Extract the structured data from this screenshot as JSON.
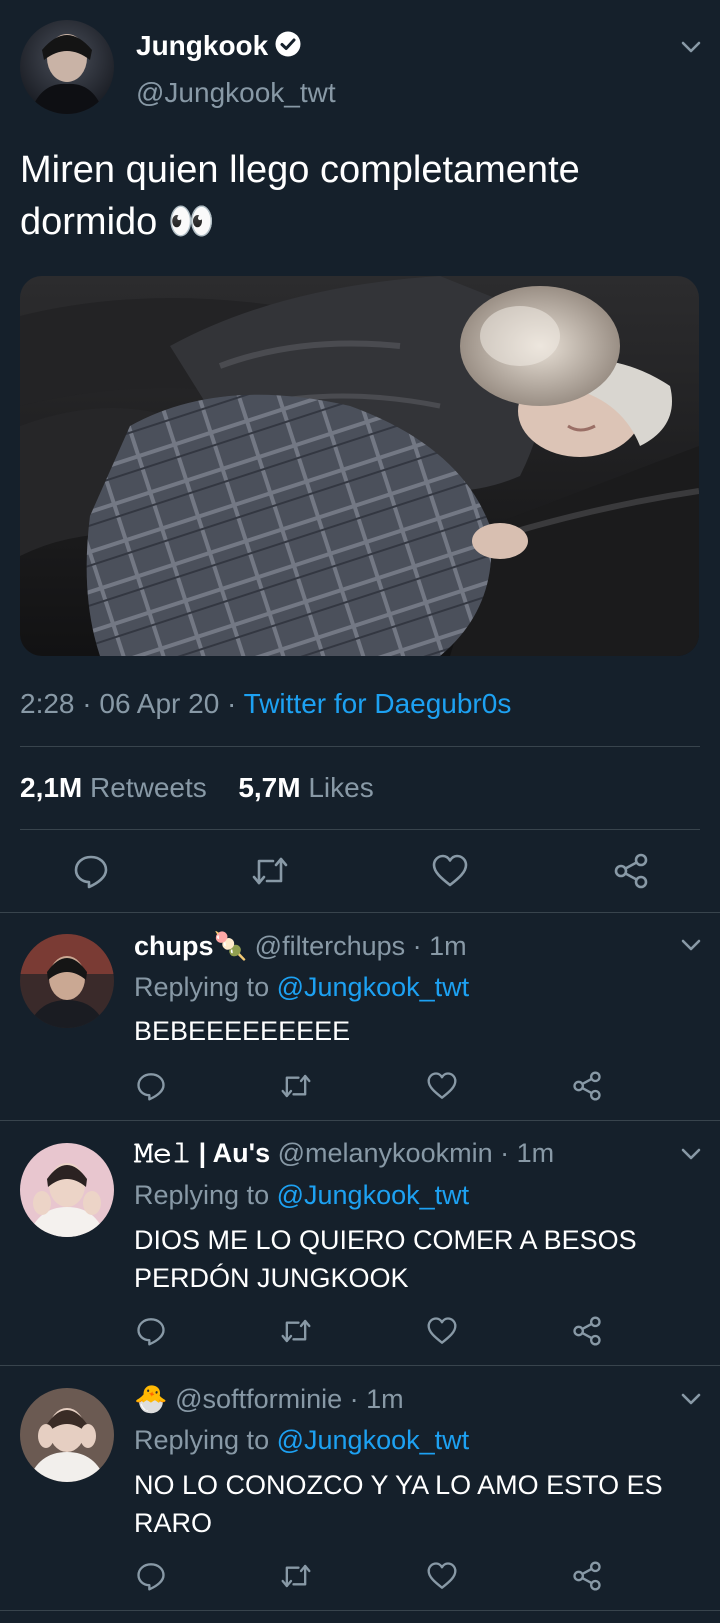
{
  "main_tweet": {
    "display_name": "Jungkook",
    "handle": "@Jungkook_twt",
    "text_line1": "Miren quien llego completamente",
    "text_line2": "dormido 👀",
    "time": "2:28",
    "date": "06 Apr 20",
    "source": "Twitter for Daegubr0s",
    "separator": "·",
    "retweets_count": "2,1M",
    "retweets_label": "Retweets",
    "likes_count": "5,7M",
    "likes_label": "Likes"
  },
  "replies": [
    {
      "display_name": "chups🍡",
      "handle": "@filterchups",
      "time": "· 1m",
      "replying_label": "Replying to",
      "replying_to": "@Jungkook_twt",
      "text_line1": "BEBEEEEEEEEE",
      "text_line2": ""
    },
    {
      "display_name": "𝙼𝚎𝚕 | Au's",
      "handle": "@melanykookmin",
      "time": "· 1m",
      "replying_label": "Replying to",
      "replying_to": "@Jungkook_twt",
      "text_line1": "DIOS ME LO QUIERO COMER A BESOS",
      "text_line2": "PERDÓN JUNGKOOK"
    },
    {
      "display_name": "🐣",
      "handle": "@softforminie",
      "time": "· 1m",
      "replying_label": "Replying to",
      "replying_to": "@Jungkook_twt",
      "text_line1": "NO LO CONOZCO Y YA LO AMO ESTO ES",
      "text_line2": "RARO"
    }
  ],
  "colors": {
    "background": "#15202b",
    "text": "#ffffff",
    "muted": "#8899a6",
    "accent": "#1da1f2",
    "divider": "#38444d"
  },
  "icons": [
    "chevron-down-icon",
    "verified-badge-icon",
    "reply-icon",
    "retweet-icon",
    "like-icon",
    "share-icon"
  ]
}
